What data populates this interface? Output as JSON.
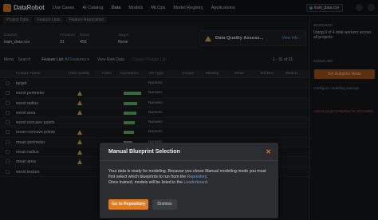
{
  "app": {
    "logo_text": "DataRobot"
  },
  "nav": {
    "items": [
      "Use Cases",
      "AI Catalog",
      "Data",
      "Models",
      "MLOps",
      "Model Registry",
      "Applications"
    ],
    "project_select": "train_data.csv"
  },
  "breadcrumbs": [
    "Project Data",
    "Feature Lists",
    "Feature Association"
  ],
  "info": {
    "dataset_label": "Dataset",
    "dataset_value": "train_data.csv",
    "features_label": "Features",
    "features_value": "31",
    "rows_label": "Rows",
    "rows_value": "455",
    "target_label": "Target",
    "target_value": "None"
  },
  "data_quality": {
    "title": "Data Quality Assess...",
    "link": "View Info ›"
  },
  "toolbar": {
    "menu": "Menu",
    "search": "Search",
    "feature_list_label": "Feature List:",
    "feature_list_value": "All Features ▾",
    "view_raw": "View Raw Data",
    "create_list": "Create Feature List",
    "pager": "1 - 31 of 31"
  },
  "table": {
    "headers": [
      "Feature Name",
      "Data Quality",
      "Index",
      "Importance",
      "Var Type",
      "Unique",
      "Missing",
      "Mean",
      "Std Dev",
      "Median",
      "Min",
      "Max"
    ],
    "rows": [
      {
        "name": "target",
        "warn": false,
        "importance": 0,
        "vtype": "Numeric"
      },
      {
        "name": "worst perimeter",
        "warn": true,
        "importance": 0.78,
        "vtype": "Numeric"
      },
      {
        "name": "worst radius",
        "warn": true,
        "importance": 0.62,
        "vtype": "Numeric"
      },
      {
        "name": "worst area",
        "warn": true,
        "importance": 0.58,
        "vtype": "Numeric"
      },
      {
        "name": "worst concave points",
        "warn": false,
        "importance": 0.5,
        "vtype": "Numeric"
      },
      {
        "name": "mean concave points",
        "warn": true,
        "importance": 0.46,
        "vtype": "Numeric"
      },
      {
        "name": "mean perimeter",
        "warn": true,
        "importance": 0.4,
        "vtype": "Numeric"
      },
      {
        "name": "mean radius",
        "warn": true,
        "importance": 0.36,
        "vtype": "Numeric"
      },
      {
        "name": "mean area",
        "warn": true,
        "importance": 0.3,
        "vtype": "Numeric"
      },
      {
        "name": "worst texture",
        "warn": false,
        "importance": 0.2,
        "vtype": "Numeric"
      }
    ]
  },
  "right_panel": {
    "workers_label": "WORKERS",
    "workers_text": "Using 0 of 4 total workers across all projects",
    "modeling_label": "MODELING",
    "start_button": "Set Autopilot Mode",
    "info_link": "Configure modeling settings",
    "unlock_link": "Unlock project Holdout for all models"
  },
  "modal": {
    "title": "Manual Blueprint Selection",
    "close": "✕",
    "body_1": "Your data is ready for modeling. Because you chose Manual modeling mode you must",
    "body_2": "first select which blueprints to run from the",
    "body_link_1": "Repository",
    "body_3": "Once trained, models will be listed in the",
    "body_link_2": "Leaderboard",
    "primary": "Go to Repository",
    "secondary": "Dismiss"
  },
  "colors": {
    "accent": "#e07b1f",
    "link": "#6e9bd8",
    "warning": "#e3b23c",
    "importance_bar": "#5ec46b"
  }
}
